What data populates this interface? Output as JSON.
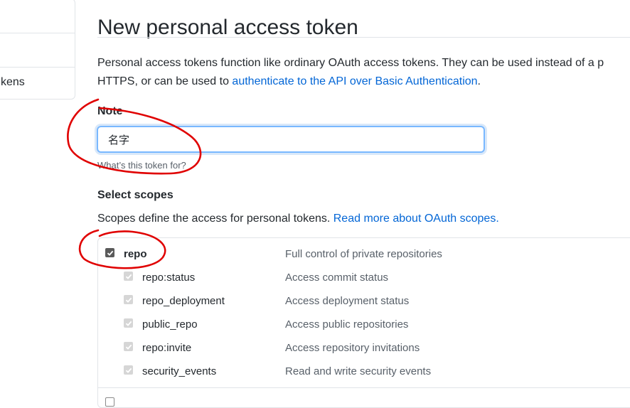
{
  "sidebar": {
    "item_label": "kens"
  },
  "page": {
    "title": "New personal access token"
  },
  "intro": {
    "line1": "Personal access tokens function like ordinary OAuth access tokens. They can be used instead of a p",
    "line2_prefix": "HTTPS, or can be used to ",
    "line2_link": "authenticate to the API over Basic Authentication",
    "line2_suffix": "."
  },
  "note": {
    "label": "Note",
    "value": "名字",
    "hint": "What’s this token for?"
  },
  "scopes": {
    "label": "Select scopes",
    "desc_prefix": "Scopes define the access for personal tokens. ",
    "desc_link": "Read more about OAuth scopes.",
    "parent": {
      "name": "repo",
      "description": "Full control of private repositories",
      "checked": true
    },
    "children": [
      {
        "name": "repo:status",
        "description": "Access commit status",
        "checked": true
      },
      {
        "name": "repo_deployment",
        "description": "Access deployment status",
        "checked": true
      },
      {
        "name": "public_repo",
        "description": "Access public repositories",
        "checked": true
      },
      {
        "name": "repo:invite",
        "description": "Access repository invitations",
        "checked": true
      },
      {
        "name": "security_events",
        "description": "Read and write security events",
        "checked": true
      }
    ]
  },
  "colors": {
    "link": "#0366d6",
    "annotation": "#e00000",
    "focus_border": "#79b8ff"
  }
}
